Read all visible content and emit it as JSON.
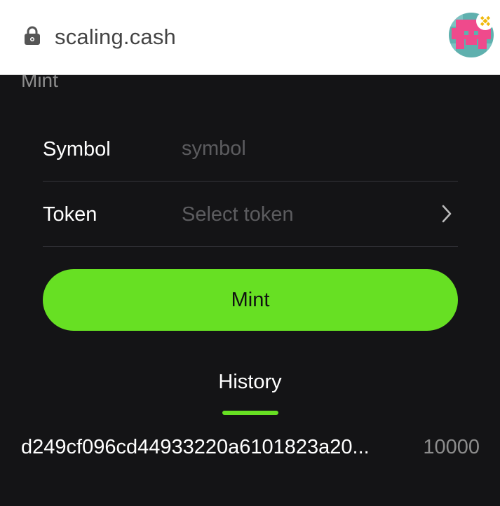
{
  "browser": {
    "url": "scaling.cash",
    "lock_icon": "lock-icon",
    "avatar_icon": "pixel-avatar-with-binance-badge"
  },
  "page": {
    "section_title": "Mint"
  },
  "form": {
    "symbol": {
      "label": "Symbol",
      "placeholder": "symbol",
      "value": ""
    },
    "token": {
      "label": "Token",
      "placeholder": "Select token",
      "chevron_icon": "chevron-right-icon"
    },
    "mint_button_label": "Mint"
  },
  "history": {
    "tab_label": "History",
    "items": [
      {
        "tx": "d249cf096cd44933220a6101823a20...",
        "amount": "10000"
      }
    ]
  },
  "colors": {
    "accent": "#67e023",
    "background": "#141416",
    "muted_text": "#5c5c5f",
    "divider": "#34343a"
  }
}
